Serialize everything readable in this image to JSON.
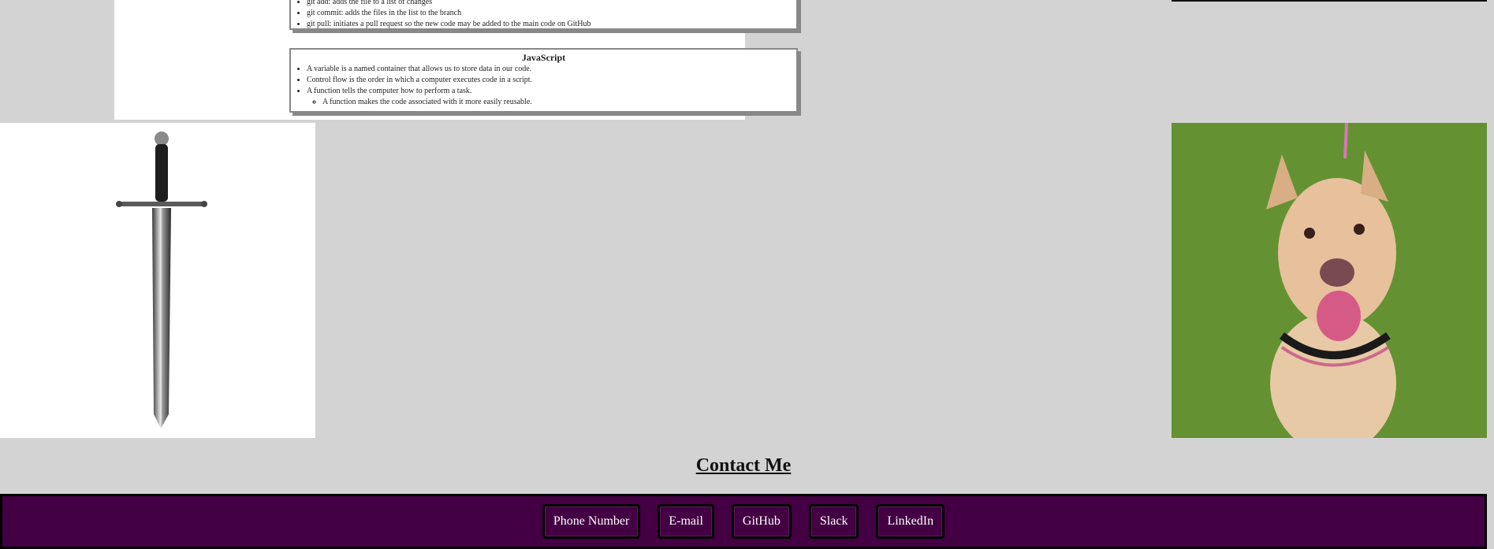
{
  "git_card": {
    "items": [
      "git add: adds the file to a list of changes",
      "git commit: adds the files in the list to the branch",
      "git pull: initiates a pull request so the new code may be added to the main code on GitHub"
    ]
  },
  "js_card": {
    "title": "JavaScript",
    "items": [
      "A variable is a named container that allows us to store data in our code.",
      "Control flow is the order in which a computer executes code in a script.",
      "A function tells the computer how to perform a task."
    ],
    "subitem": "A function makes the code associated with it more easily reusable."
  },
  "images": {
    "left": "sword-image",
    "right": "dog-photo"
  },
  "contact": {
    "heading": "Contact Me"
  },
  "footer": {
    "links": [
      "Phone Number",
      "E-mail",
      "GitHub",
      "Slack",
      "LinkedIn"
    ]
  },
  "colors": {
    "page_bg": "#d3d3d3",
    "footer_bg": "#430043"
  }
}
